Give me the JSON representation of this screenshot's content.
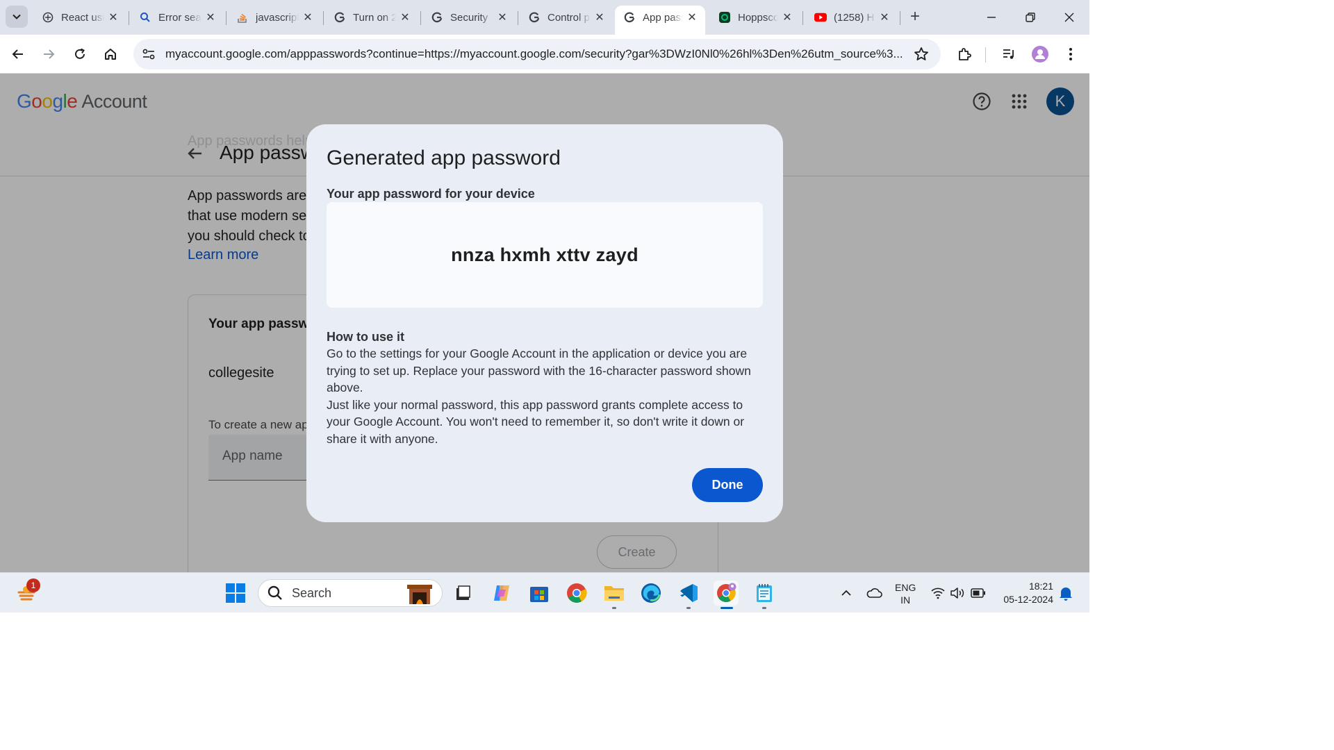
{
  "browser": {
    "tabs": [
      {
        "title": "React usi",
        "icon": "openai-icon"
      },
      {
        "title": "Error sea",
        "icon": "search-icon"
      },
      {
        "title": "javascript",
        "icon": "stackoverflow-icon"
      },
      {
        "title": "Turn on 2",
        "icon": "google-icon"
      },
      {
        "title": "Security",
        "icon": "google-icon"
      },
      {
        "title": "Control p",
        "icon": "google-icon"
      },
      {
        "title": "App pass",
        "icon": "google-icon",
        "active": true
      },
      {
        "title": "Hoppsco",
        "icon": "hoppscotch-icon"
      },
      {
        "title": "(1258) H",
        "icon": "youtube-icon"
      }
    ],
    "url": "myaccount.google.com/apppasswords?continue=https://myaccount.google.com/security?gar%3DWzI0Nl0%26hl%3Den%26utm_source%3..."
  },
  "header": {
    "logo_word": "Google",
    "logo_suffix": "Account",
    "avatar_letter": "K"
  },
  "page": {
    "title": "App passw",
    "ghost_title": "App passwords help",
    "intro_lines": [
      "App passwords are",
      "that use modern se",
      "you should check to"
    ],
    "learn_more": "Learn more",
    "card": {
      "title": "Your app passw",
      "app_name": "collegesite",
      "hint": "To create a new ap",
      "input_placeholder": "App name",
      "create_label": "Create"
    }
  },
  "dialog": {
    "title": "Generated app password",
    "subtitle": "Your app password for your device",
    "password": "nnza hxmh xttv zayd",
    "how_title": "How to use it",
    "how_lines": [
      "Go to the settings for your Google Account in the application or device you are",
      "trying to set up. Replace your password with the 16-character password shown",
      "above.",
      "Just like your normal password, this app password grants complete access to",
      "your Google Account. You won't need to remember it, so don't write it down or",
      "share it with anyone."
    ],
    "done_label": "Done"
  },
  "taskbar": {
    "search_placeholder": "Search",
    "weather_badge": "1",
    "lang_top": "ENG",
    "lang_bottom": "IN",
    "time": "18:21",
    "date": "05-12-2024"
  },
  "colors": {
    "accent": "#0b57d0",
    "dialog_bg": "#e9eef6",
    "avatar": "#0b5394"
  }
}
